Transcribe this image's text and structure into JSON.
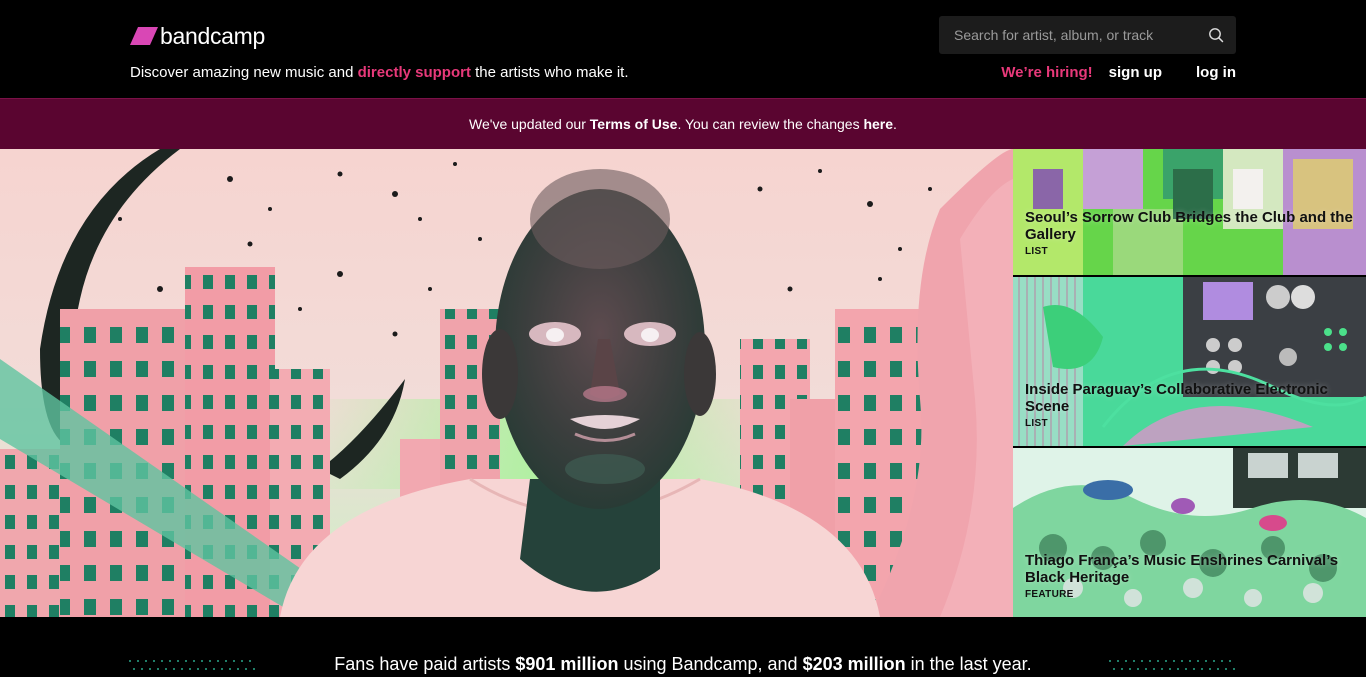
{
  "header": {
    "logo_text": "bandcamp",
    "tagline_before": "Discover amazing new music and ",
    "tagline_accent": "directly support",
    "tagline_after": " the artists who make it.",
    "search_placeholder": "Search for artist, album, or track",
    "hiring": "We’re hiring!",
    "signup": "sign up",
    "login": "log in"
  },
  "banner": {
    "text_1": "We've updated our ",
    "terms": "Terms of Use",
    "text_2": ". You can review the changes ",
    "here": "here",
    "text_3": "."
  },
  "stories": [
    {
      "title": "Seoul’s Sorrow Club Bridges the Club and the Gallery",
      "kind": "LIST"
    },
    {
      "title": "Inside Paraguay’s Collaborative Electronic Scene",
      "kind": "LIST"
    },
    {
      "title": "Thiago França’s Music Enshrines Carnival’s Black Heritage",
      "kind": "FEATURE"
    }
  ],
  "stats": {
    "t1": "Fans have paid artists ",
    "v1": "$901 million",
    "t2": " using Bandcamp, and ",
    "v2": "$203 million",
    "t3": " in the last year."
  },
  "colors": {
    "accent": "#e8397a",
    "banner_bg": "#5a0530",
    "logo_mark": "#d947b5"
  }
}
